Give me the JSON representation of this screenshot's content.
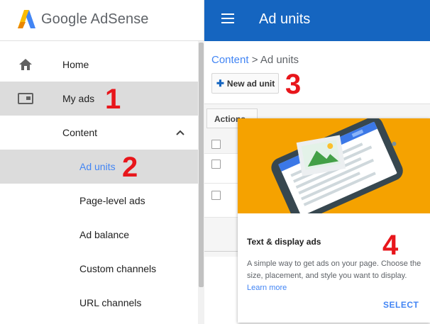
{
  "app": {
    "logo_text": "Google AdSense",
    "page_title": "Ad units"
  },
  "sidebar": {
    "items": [
      {
        "label": "Home",
        "icon": "home-icon"
      },
      {
        "label": "My ads",
        "icon": "ads-icon",
        "selected": true
      },
      {
        "label": "Content",
        "expanded": true
      },
      {
        "label": "Ad units",
        "active": true
      },
      {
        "label": "Page-level ads"
      },
      {
        "label": "Ad balance"
      },
      {
        "label": "Custom channels"
      },
      {
        "label": "URL channels"
      }
    ]
  },
  "breadcrumb": {
    "parent": "Content",
    "separator": " > ",
    "current": "Ad units"
  },
  "toolbar": {
    "new_ad_unit_label": "New ad unit",
    "actions_label": "Actions"
  },
  "card": {
    "title": "Text & display ads",
    "description": "A simple way to get ads on your page. Choose the size, placement, and style you want to display.",
    "learn_more": "Learn more",
    "select_label": "SELECT"
  },
  "callouts": [
    "1",
    "2",
    "3",
    "4"
  ],
  "colors": {
    "header_blue": "#1565c0",
    "link_blue": "#4285f4",
    "card_hero": "#f5a200",
    "callout_red": "#e8161b",
    "selected_row": "#dcdcdc"
  }
}
